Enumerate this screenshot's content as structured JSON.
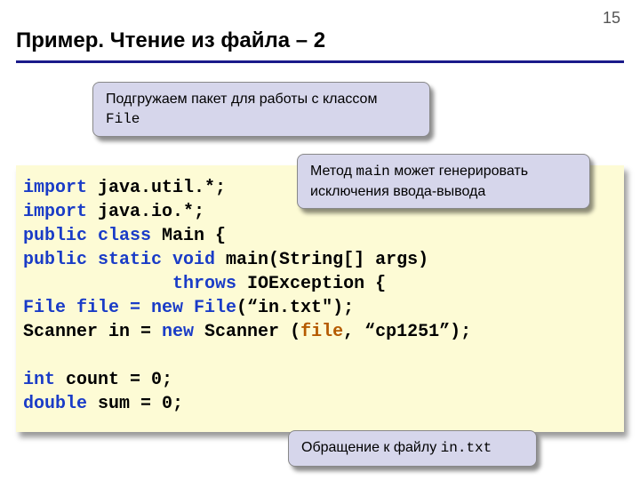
{
  "page_number": "15",
  "title": "Пример. Чтение из файла – 2",
  "callout_top_text": "Подгружаем пакет для работы с классом",
  "callout_top_mono": "File",
  "callout_mid_a": "Метод ",
  "callout_mid_mono": "main",
  "callout_mid_b": " может генерировать исключения ввода-вывода",
  "callout_bottom_a": "Обращение к файлу ",
  "callout_bottom_mono": "in.txt",
  "code": {
    "l1a": "import",
    "l1b": " java.util.*;",
    "l2a": "import",
    "l2b": " java.io.*;",
    "l3a": "public class",
    "l3b": " Main {",
    "l4a": "public static void",
    "l4b": " main(String[] args)",
    "l5a": "              throws",
    "l5b": " IOException {",
    "l6a": "File file = new File",
    "l6b": "(“in.txt\");",
    "l7a": "Scanner in = ",
    "l7b": "new",
    "l7c": " Scanner (",
    "l7d": "file",
    "l7e": ", “cp1251”);",
    "l8": "",
    "l9a": "int",
    "l9b": " count = 0;",
    "l10a": "double",
    "l10b": " sum = 0;"
  }
}
